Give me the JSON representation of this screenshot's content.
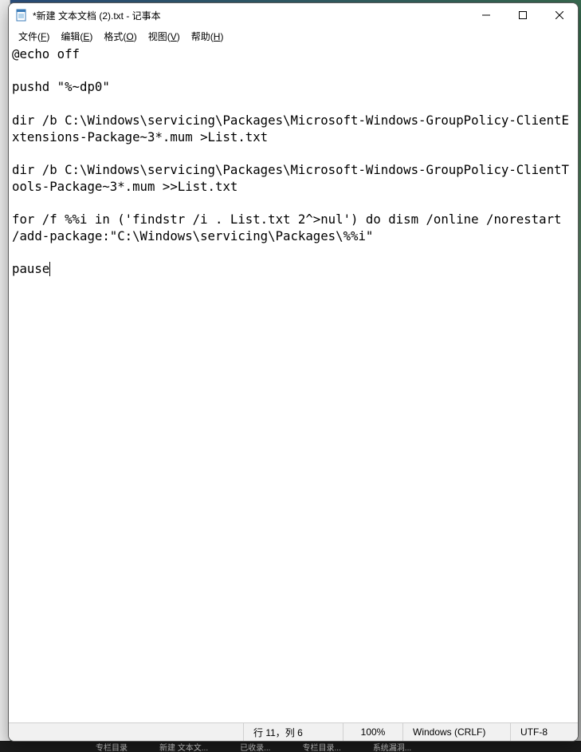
{
  "window": {
    "title": "*新建 文本文档 (2).txt - 记事本"
  },
  "menu": {
    "file": {
      "label": "文件",
      "accel": "F"
    },
    "edit": {
      "label": "编辑",
      "accel": "E"
    },
    "format": {
      "label": "格式",
      "accel": "O"
    },
    "view": {
      "label": "视图",
      "accel": "V"
    },
    "help": {
      "label": "帮助",
      "accel": "H"
    }
  },
  "editor": {
    "content": "@echo off\n\npushd \"%~dp0\"\n\ndir /b C:\\Windows\\servicing\\Packages\\Microsoft-Windows-GroupPolicy-ClientExtensions-Package~3*.mum >List.txt\n\ndir /b C:\\Windows\\servicing\\Packages\\Microsoft-Windows-GroupPolicy-ClientTools-Package~3*.mum >>List.txt\n\nfor /f %%i in ('findstr /i . List.txt 2^>nul') do dism /online /norestart /add-package:\"C:\\Windows\\servicing\\Packages\\%%i\"\n\npause"
  },
  "status": {
    "position": "行 11，列 6",
    "zoom": "100%",
    "eol": "Windows (CRLF)",
    "encoding": "UTF-8"
  },
  "taskbar": {
    "item1": "专栏目录",
    "item2": "新建 文本文...",
    "item3": "已收录...",
    "item4": "专栏目录...",
    "item5": "系统漏洞..."
  }
}
